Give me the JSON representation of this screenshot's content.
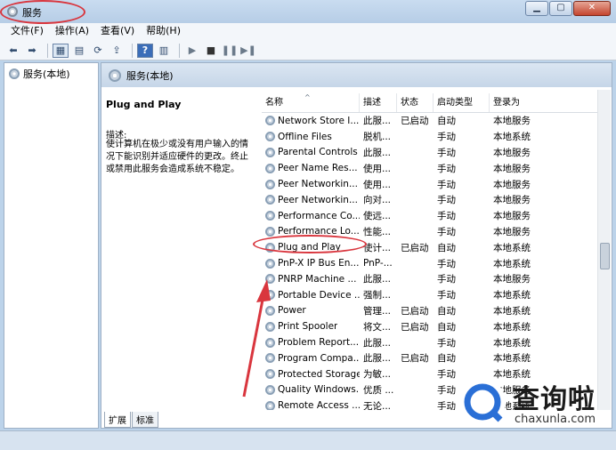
{
  "window": {
    "title": "服务"
  },
  "menubar": {
    "items": [
      "文件(F)",
      "操作(A)",
      "查看(V)",
      "帮助(H)"
    ]
  },
  "tree": {
    "root_label": "服务(本地)"
  },
  "pane": {
    "header": "服务(本地)",
    "selected_service": "Plug and Play",
    "description_label": "描述:",
    "description_text": "使计算机在极少或没有用户输入的情况下能识别并适应硬件的更改。终止或禁用此服务会造成系统不稳定。"
  },
  "table": {
    "columns": [
      "名称",
      "描述",
      "状态",
      "启动类型",
      "登录为"
    ],
    "rows": [
      {
        "name": "Network Store I...",
        "desc": "此服...",
        "status": "已启动",
        "startup": "自动",
        "logon": "本地服务"
      },
      {
        "name": "Offline Files",
        "desc": "脱机...",
        "status": "",
        "startup": "手动",
        "logon": "本地系统"
      },
      {
        "name": "Parental Controls",
        "desc": "此服...",
        "status": "",
        "startup": "手动",
        "logon": "本地服务"
      },
      {
        "name": "Peer Name Res...",
        "desc": "使用...",
        "status": "",
        "startup": "手动",
        "logon": "本地服务"
      },
      {
        "name": "Peer Networkin...",
        "desc": "使用...",
        "status": "",
        "startup": "手动",
        "logon": "本地服务"
      },
      {
        "name": "Peer Networkin...",
        "desc": "向对...",
        "status": "",
        "startup": "手动",
        "logon": "本地服务"
      },
      {
        "name": "Performance Co...",
        "desc": "使远...",
        "status": "",
        "startup": "手动",
        "logon": "本地服务"
      },
      {
        "name": "Performance Lo...",
        "desc": "性能...",
        "status": "",
        "startup": "手动",
        "logon": "本地服务"
      },
      {
        "name": "Plug and Play",
        "desc": "使计...",
        "status": "已启动",
        "startup": "自动",
        "logon": "本地系统"
      },
      {
        "name": "PnP-X IP Bus En...",
        "desc": "PnP-...",
        "status": "",
        "startup": "手动",
        "logon": "本地系统"
      },
      {
        "name": "PNRP Machine ...",
        "desc": "此服...",
        "status": "",
        "startup": "手动",
        "logon": "本地服务"
      },
      {
        "name": "Portable Device ...",
        "desc": "强制...",
        "status": "",
        "startup": "手动",
        "logon": "本地系统"
      },
      {
        "name": "Power",
        "desc": "管理...",
        "status": "已启动",
        "startup": "自动",
        "logon": "本地系统"
      },
      {
        "name": "Print Spooler",
        "desc": "将文...",
        "status": "已启动",
        "startup": "自动",
        "logon": "本地系统"
      },
      {
        "name": "Problem Report...",
        "desc": "此服...",
        "status": "",
        "startup": "手动",
        "logon": "本地系统"
      },
      {
        "name": "Program Compa...",
        "desc": "此服...",
        "status": "已启动",
        "startup": "自动",
        "logon": "本地系统"
      },
      {
        "name": "Protected Storage",
        "desc": "为敏...",
        "status": "",
        "startup": "手动",
        "logon": "本地系统"
      },
      {
        "name": "Quality Windows...",
        "desc": "优质 ...",
        "status": "",
        "startup": "手动",
        "logon": "本地服务"
      },
      {
        "name": "Remote Access ...",
        "desc": "无论...",
        "status": "",
        "startup": "手动",
        "logon": "本地系统"
      }
    ]
  },
  "tabs": [
    "扩展",
    "标准"
  ],
  "watermark": {
    "brand": "查询啦",
    "url": "chaxunla.com"
  },
  "icons": [
    "services-icon",
    "gear-icon",
    "back-arrow-icon",
    "forward-arrow-icon",
    "help-icon",
    "play-icon",
    "stop-icon",
    "pause-icon",
    "restart-icon"
  ],
  "colors": {
    "annotation": "#d9363e",
    "accent": "#2a6fd6"
  }
}
